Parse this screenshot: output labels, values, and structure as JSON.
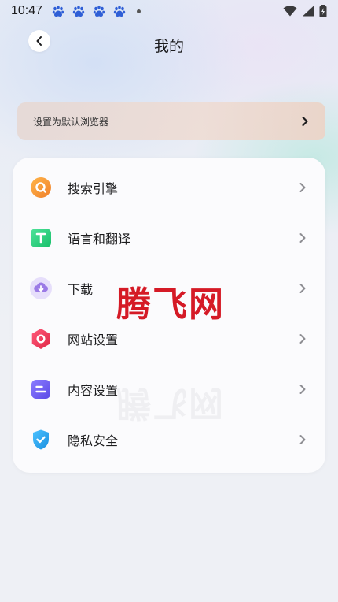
{
  "status_bar": {
    "time": "10:47",
    "notification_icons": [
      "baidu-paw-icon",
      "baidu-paw-icon",
      "baidu-paw-icon",
      "baidu-paw-icon"
    ],
    "right_icons": [
      "wifi-icon",
      "signal-icon",
      "battery-icon"
    ]
  },
  "header": {
    "title": "我的",
    "back_icon": "chevron-left-icon"
  },
  "banner": {
    "label": "设置为默认浏览器"
  },
  "menu": {
    "items": [
      {
        "label": "搜索引擎",
        "icon": "search-engine-icon",
        "color": "#f39a2e"
      },
      {
        "label": "语言和翻译",
        "icon": "translate-icon",
        "color": "#2ed17a"
      },
      {
        "label": "下载",
        "icon": "download-cloud-icon",
        "color": "#9b7ae6"
      },
      {
        "label": "网站设置",
        "icon": "website-settings-icon",
        "color": "#ef3b5c"
      },
      {
        "label": "内容设置",
        "icon": "content-settings-icon",
        "color": "#6e5df0"
      },
      {
        "label": "隐私安全",
        "icon": "privacy-shield-icon",
        "color": "#2aa4ee"
      }
    ]
  },
  "watermark": {
    "text": "腾飞网"
  },
  "colors": {
    "background": "#eef0f5",
    "card": "#fbfbfd",
    "watermark": "#d51a26",
    "paw": "#2f5fd6"
  }
}
